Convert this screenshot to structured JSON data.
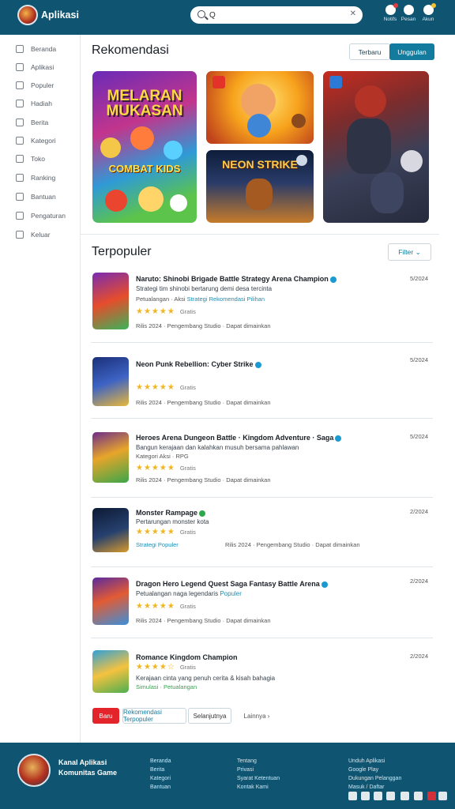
{
  "header": {
    "app_title": "Aplikasi",
    "search": {
      "value": "Q",
      "placeholder": ""
    },
    "icons": [
      {
        "name": "notifications-icon",
        "caption": "Notifs"
      },
      {
        "name": "messages-icon",
        "caption": "Pesan"
      },
      {
        "name": "profile-icon",
        "caption": "Akun"
      }
    ]
  },
  "sidebar": {
    "items": [
      {
        "label": "Beranda",
        "icon": "home-icon"
      },
      {
        "label": "Aplikasi",
        "icon": "apps-icon"
      },
      {
        "label": "Populer",
        "icon": "fire-icon"
      },
      {
        "label": "Hadiah",
        "icon": "gift-icon"
      },
      {
        "label": "Berita",
        "icon": "news-icon"
      },
      {
        "label": "Kategori",
        "icon": "category-icon"
      },
      {
        "label": "Toko",
        "icon": "store-icon"
      },
      {
        "label": "Ranking",
        "icon": "trophy-icon"
      },
      {
        "label": "Bantuan",
        "icon": "help-icon"
      },
      {
        "label": "Pengaturan",
        "icon": "settings-icon"
      },
      {
        "label": "Keluar",
        "icon": "logout-icon"
      }
    ]
  },
  "featured": {
    "title": "Rekomendasi",
    "seg_left": "Terbaru",
    "seg_right": "Unggulan",
    "tiles": [
      {
        "art_title": "MELARAN MUKASAN",
        "art_sub": "COMBAT KIDS",
        "badge": ""
      },
      {
        "art_title": "",
        "badge": "red"
      },
      {
        "art_title": "NEON STRIKE",
        "badge": ""
      },
      {
        "art_title": "",
        "badge": "blue"
      }
    ]
  },
  "list": {
    "title": "Terpopuler",
    "sort_label": "Filter",
    "rows": [
      {
        "title": "Naruto: Shinobi Brigade Battle Strategy Arena Champion",
        "sub": "Strategi tim shinobi bertarung demi desa tercinta",
        "tags_plain": "Petualangan · Aksi",
        "tags_hl": "Strategi Rekomendasi Pilihan",
        "stars": "★★★★★",
        "rating": "Gratis",
        "meta": "Rilis 2024 · Pengembang Studio · Dapat dimainkan",
        "date": "5/2024"
      },
      {
        "title": "Neon Punk Rebellion: Cyber Strike",
        "sub": "",
        "tags_plain": "",
        "tags_hl": "",
        "stars": "★★★★★",
        "rating": "Gratis",
        "meta": "Rilis 2024 · Pengembang Studio · Dapat dimainkan",
        "date": "5/2024"
      },
      {
        "title": "Heroes Arena Dungeon Battle · Kingdom Adventure · Saga",
        "sub": "Bangun kerajaan dan kalahkan musuh bersama pahlawan",
        "tags_plain": "Kategori Aksi · RPG",
        "tags_hl": "",
        "stars": "★★★★★",
        "rating": "Gratis",
        "meta": "Rilis 2024 · Pengembang Studio · Dapat dimainkan",
        "date": "5/2024"
      },
      {
        "title": "Monster Rampage",
        "sub": "Pertarungan monster kota",
        "tags_plain": "",
        "tags_hl": "Strategi Populer",
        "stars": "★★★★★",
        "rating": "Gratis",
        "meta": "Rilis 2024 · Pengembang Studio · Dapat dimainkan",
        "date": "2/2024"
      },
      {
        "title": "Dragon Hero Legend Quest Saga Fantasy Battle Arena",
        "sub": "Petualangan naga legendaris",
        "tags_plain": "",
        "tags_hl": "Populer",
        "stars": "★★★★★",
        "rating": "Gratis",
        "meta": "Rilis 2024 · Pengembang Studio · Dapat dimainkan",
        "date": "2/2024"
      },
      {
        "title": "Romance Kingdom Champion",
        "sub": "Kerajaan cinta yang penuh cerita & kisah bahagia",
        "tags_plain": "",
        "tags_hl": "Simulasi · Petualangan",
        "stars": "★★★★☆",
        "rating": "Gratis",
        "meta": "",
        "date": "2/2024"
      }
    ]
  },
  "pagination": {
    "prev": "Baru",
    "current": "Rekomendasi Terpopuler",
    "next": "Selanjutnya",
    "more": "Lainnya ›"
  },
  "footer": {
    "brand_line1": "Kanal Aplikasi",
    "brand_line2": "Komunitas Game",
    "col1": [
      "Beranda",
      "Berita",
      "Kategori",
      "Bantuan"
    ],
    "col2": [
      "Tentang",
      "Privasi",
      "Syarat Ketentuan",
      "Kontak Kami"
    ],
    "col3": [
      "Unduh Aplikasi",
      "Google Play",
      "Dukungan Pelanggan",
      "Masuk / Daftar"
    ]
  },
  "colors": {
    "header_bg": "#0f5572",
    "accent": "#137b9e",
    "star": "#f3b51e",
    "badge_red": "#e3242b"
  }
}
